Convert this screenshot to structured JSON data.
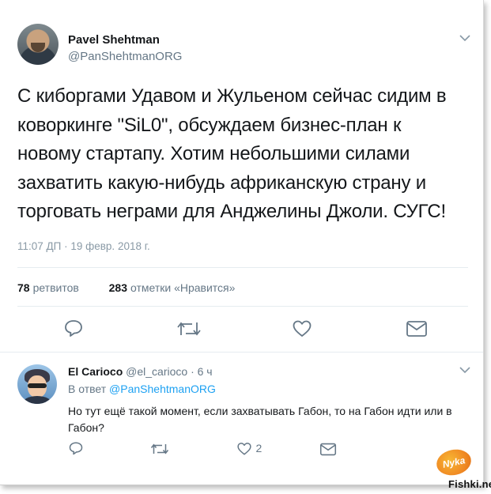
{
  "tweet": {
    "author_name": "Pavel Shehtman",
    "author_handle": "@PanShehtmanORG",
    "text": "С киборгами Удавом и Жульеном сейчас сидим в коворкинге \"SiL0\", обсуждаем бизнес-план к новому стартапу.  Хотим небольшими силами захватить какую-нибудь африканскую страну и торговать неграми для Анджелины Джоли. СУГС!",
    "timestamp": "11:07 ДП · 19 февр. 2018 г.",
    "retweets_count": "78",
    "retweets_label": "ретвитов",
    "likes_count": "283",
    "likes_label": "отметки «Нравится»"
  },
  "reply": {
    "author_name": "El Carioco",
    "author_handle": "@el_carioco",
    "age": "6 ч",
    "replying_to_prefix": "В ответ",
    "replying_to_handle": "@PanShehtmanORG",
    "text": "Но тут ещё такой момент, если захватывать Габон, то на Габон идти или в Габон?",
    "likes_count": "2"
  },
  "watermark": {
    "badge_text": "Nyka",
    "site": "Fishki.net"
  },
  "icons": [
    "chevron-down-icon",
    "reply-icon",
    "retweet-icon",
    "like-icon",
    "message-icon"
  ],
  "colors": {
    "text": "#14171a",
    "muted": "#657786",
    "link": "#1da1f2",
    "separator": "#e6ecf0"
  }
}
